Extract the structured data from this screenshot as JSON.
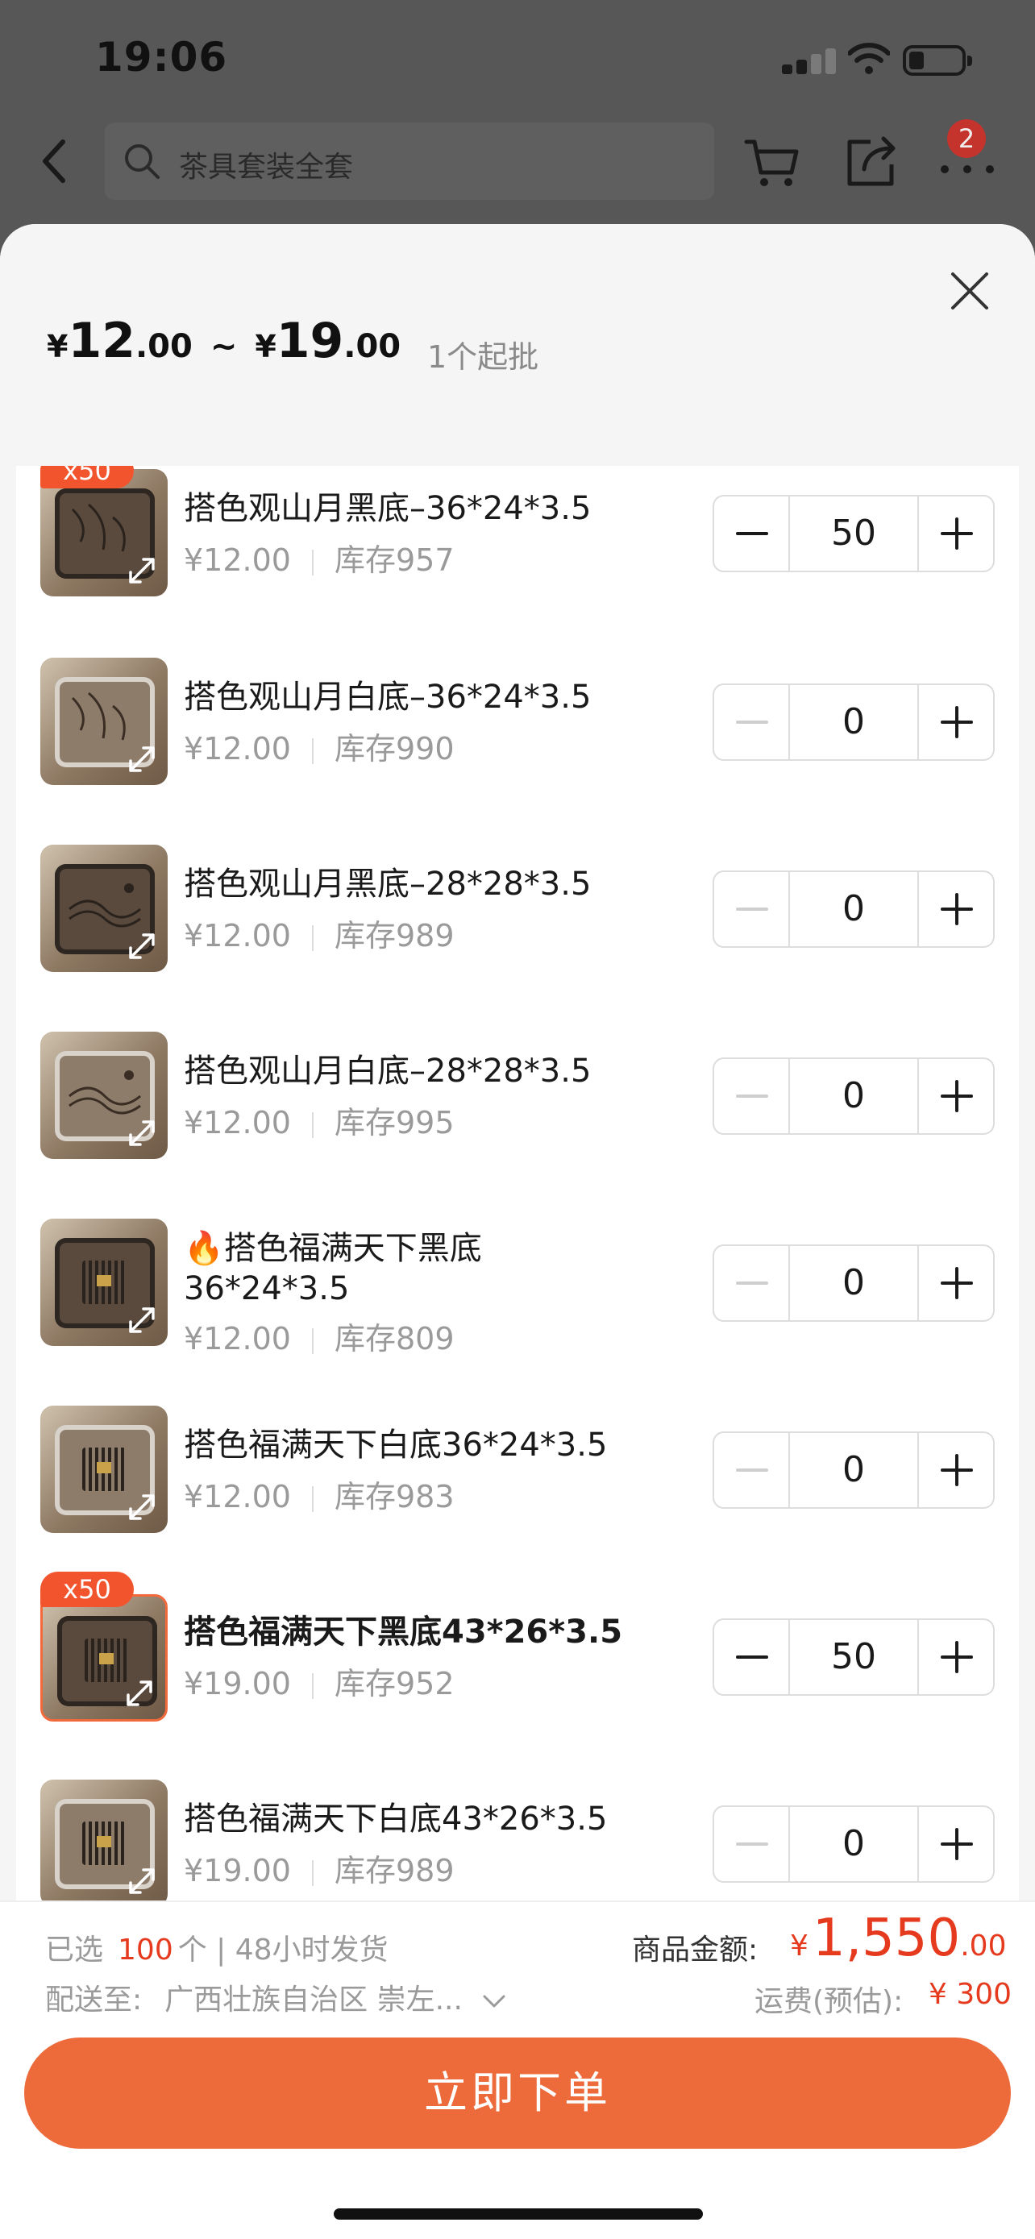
{
  "status_bar": {
    "time": "19:06"
  },
  "nav": {
    "search_placeholder": "茶具套装全套",
    "notification_count": "2"
  },
  "sheet": {
    "price_currency": "¥",
    "price_min_int": "12",
    "price_min_dec": ".00",
    "price_sep": "~",
    "price_max_int": "19",
    "price_max_dec": ".00",
    "moq": "1个起批"
  },
  "items": [
    {
      "name": "搭色观山月黑底–36*24*3.5",
      "price": "¥12.00",
      "stock": "库存957",
      "qty": "50",
      "badge": "x50"
    },
    {
      "name": "搭色观山月白底–36*24*3.5",
      "price": "¥12.00",
      "stock": "库存990",
      "qty": "0"
    },
    {
      "name": "搭色观山月黑底–28*28*3.5",
      "price": "¥12.00",
      "stock": "库存989",
      "qty": "0"
    },
    {
      "name": "搭色观山月白底–28*28*3.5",
      "price": "¥12.00",
      "stock": "库存995",
      "qty": "0"
    },
    {
      "name_prefix": "🔥",
      "name": "搭色福满天下黑底36*24*3.5",
      "price": "¥12.00",
      "stock": "库存809",
      "qty": "0"
    },
    {
      "name": "搭色福满天下白底36*24*3.5",
      "price": "¥12.00",
      "stock": "库存983",
      "qty": "0"
    },
    {
      "name": "搭色福满天下黑底43*26*3.5",
      "price": "¥19.00",
      "stock": "库存952",
      "qty": "50",
      "badge": "x50"
    },
    {
      "name": "搭色福满天下白底43*26*3.5",
      "price": "¥19.00",
      "stock": "库存989",
      "qty": "0"
    }
  ],
  "footer": {
    "selected_prefix": "已选",
    "selected_count": "100",
    "selected_suffix": "个 | 48小时发货",
    "ship_label": "配送至:",
    "ship_address": "广西壮族自治区 崇左...",
    "amount_label": "商品金额:",
    "amount_currency": "¥",
    "amount_int": "1,550",
    "amount_dec": ".00",
    "freight_label": "运费(预估):",
    "freight_value": "¥ 300",
    "order_button": "立即下单"
  },
  "colors": {
    "accent": "#ED6A3B",
    "price_red": "#E53A1E",
    "badge_orange": "#F2542D"
  }
}
